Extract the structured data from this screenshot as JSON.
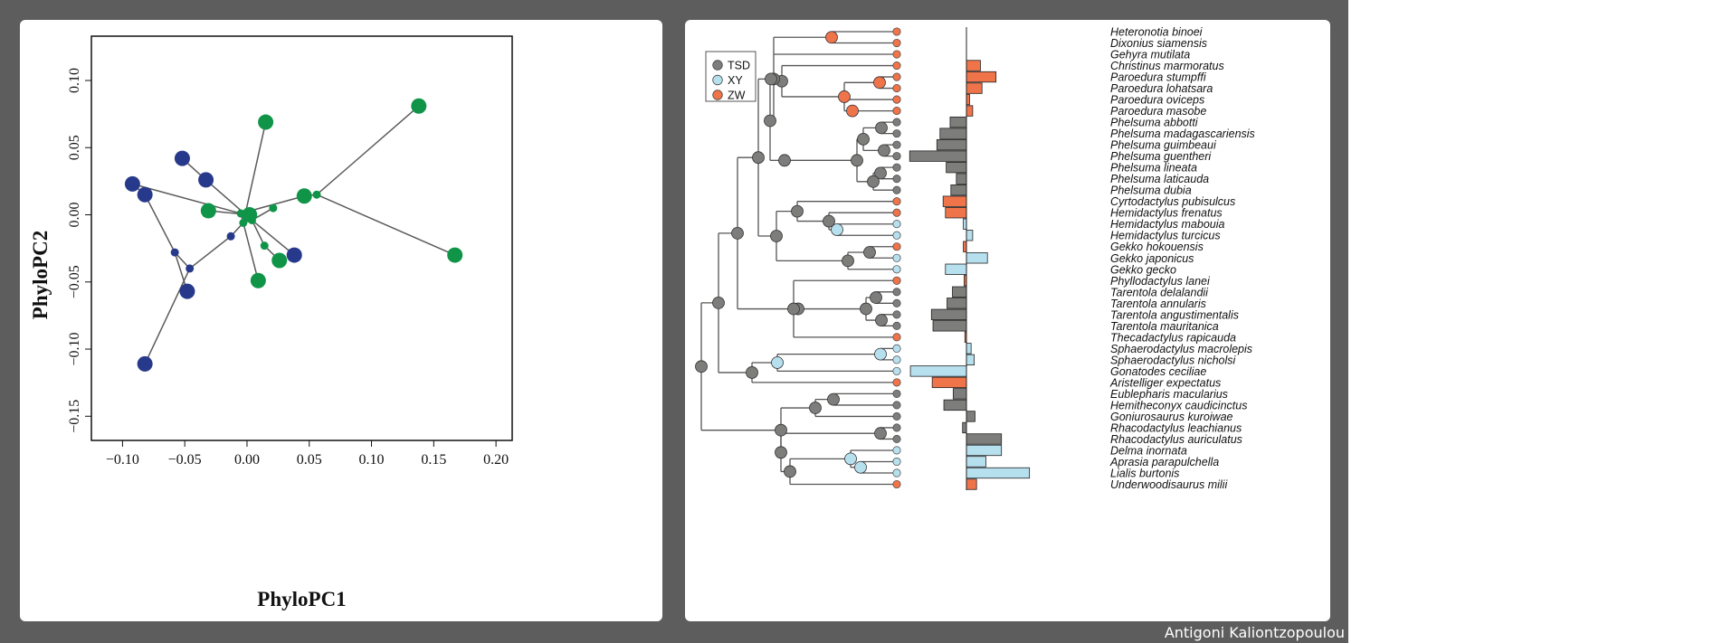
{
  "colors": {
    "TSD": "#7d7d7b",
    "XY": "#b7e0ef",
    "ZW": "#f0744a",
    "scatter_blue": "#27398a",
    "scatter_green": "#109448",
    "backdrop": "#5d5d5d"
  },
  "credit": "Antigoni Kaliontzopoulou",
  "chart_data": [
    {
      "type": "scatter",
      "xlabel": "PhyloPC1",
      "ylabel": "PhyloPC2",
      "xlim": [
        -0.125,
        0.213
      ],
      "ylim": [
        -0.168,
        0.133
      ],
      "xticks": [
        "−0.10",
        "−0.05",
        "0.00",
        "0.05",
        "0.10",
        "0.15",
        "0.20"
      ],
      "xtick_values": [
        -0.1,
        -0.05,
        0.0,
        0.05,
        0.1,
        0.15,
        0.2
      ],
      "yticks": [
        "−0.15",
        "−0.10",
        "−0.05",
        "0.00",
        "0.05",
        "0.10"
      ],
      "ytick_values": [
        -0.15,
        -0.1,
        -0.05,
        0.0,
        0.05,
        0.1
      ],
      "grid": false,
      "points": [
        {
          "id": "b1",
          "x": -0.052,
          "y": 0.042,
          "g": "blue",
          "size": "tip"
        },
        {
          "id": "b2",
          "x": -0.033,
          "y": 0.026,
          "g": "blue",
          "size": "tip"
        },
        {
          "id": "b3",
          "x": -0.092,
          "y": 0.023,
          "g": "blue",
          "size": "tip"
        },
        {
          "id": "b4",
          "x": -0.082,
          "y": 0.015,
          "g": "blue",
          "size": "tip"
        },
        {
          "id": "b5",
          "x": 0.038,
          "y": -0.03,
          "g": "blue",
          "size": "tip"
        },
        {
          "id": "b6",
          "x": -0.048,
          "y": -0.057,
          "g": "blue",
          "size": "tip"
        },
        {
          "id": "b7",
          "x": -0.082,
          "y": -0.111,
          "g": "blue",
          "size": "tip"
        },
        {
          "id": "bn1",
          "x": -0.058,
          "y": -0.028,
          "g": "blue",
          "size": "node"
        },
        {
          "id": "bn2",
          "x": -0.046,
          "y": -0.04,
          "g": "blue",
          "size": "node"
        },
        {
          "id": "bn3",
          "x": -0.013,
          "y": -0.016,
          "g": "blue",
          "size": "node"
        },
        {
          "id": "g1",
          "x": 0.138,
          "y": 0.081,
          "g": "green",
          "size": "tip"
        },
        {
          "id": "g2",
          "x": 0.015,
          "y": 0.069,
          "g": "green",
          "size": "tip"
        },
        {
          "id": "g3",
          "x": 0.046,
          "y": 0.014,
          "g": "green",
          "size": "tip"
        },
        {
          "id": "g4",
          "x": -0.031,
          "y": 0.003,
          "g": "green",
          "size": "tip"
        },
        {
          "id": "g5",
          "x": 0.002,
          "y": 0.0,
          "g": "green",
          "size": "tip"
        },
        {
          "id": "g6",
          "x": 0.167,
          "y": -0.03,
          "g": "green",
          "size": "tip"
        },
        {
          "id": "g7",
          "x": 0.026,
          "y": -0.034,
          "g": "green",
          "size": "tip"
        },
        {
          "id": "g8",
          "x": 0.009,
          "y": -0.049,
          "g": "green",
          "size": "tip"
        },
        {
          "id": "gn1",
          "x": -0.005,
          "y": 0.001,
          "g": "green",
          "size": "node"
        },
        {
          "id": "gn2",
          "x": 0.004,
          "y": -0.004,
          "g": "green",
          "size": "node"
        },
        {
          "id": "gn3",
          "x": -0.003,
          "y": -0.006,
          "g": "green",
          "size": "node"
        },
        {
          "id": "gn4",
          "x": 0.021,
          "y": 0.005,
          "g": "green",
          "size": "node"
        },
        {
          "id": "gn5",
          "x": 0.056,
          "y": 0.015,
          "g": "green",
          "size": "node"
        },
        {
          "id": "gn6",
          "x": 0.014,
          "y": -0.023,
          "g": "green",
          "size": "node"
        }
      ],
      "edges": [
        [
          "b1",
          "b2"
        ],
        [
          "b2",
          "gn2"
        ],
        [
          "b3",
          "b4"
        ],
        [
          "b3",
          "gn1"
        ],
        [
          "b4",
          "bn1"
        ],
        [
          "bn1",
          "bn2"
        ],
        [
          "bn1",
          "b6"
        ],
        [
          "bn2",
          "bn3"
        ],
        [
          "bn3",
          "gn3"
        ],
        [
          "b7",
          "bn2"
        ],
        [
          "b5",
          "gn2"
        ],
        [
          "g1",
          "gn5"
        ],
        [
          "gn5",
          "g3"
        ],
        [
          "g3",
          "gn1"
        ],
        [
          "gn5",
          "g6"
        ],
        [
          "g2",
          "gn3"
        ],
        [
          "g4",
          "g5"
        ],
        [
          "g5",
          "gn2"
        ],
        [
          "gn2",
          "gn4"
        ],
        [
          "gn2",
          "gn6"
        ],
        [
          "gn6",
          "g7"
        ],
        [
          "gn3",
          "g8"
        ],
        [
          "gn1",
          "gn3"
        ]
      ]
    },
    {
      "type": "bar",
      "legend": [
        "TSD",
        "XY",
        "ZW"
      ],
      "legend_position": "top-left",
      "categories": [
        "Heteronotia binoei",
        "Dixonius siamensis",
        "Gehyra mutilata",
        "Christinus marmoratus",
        "Paroedura stumpffi",
        "Paroedura lohatsara",
        "Paroedura oviceps",
        "Paroedura masobe",
        "Phelsuma abbotti",
        "Phelsuma madagascariensis",
        "Phelsuma guimbeaui",
        "Phelsuma guentheri",
        "Phelsuma lineata",
        "Phelsuma laticauda",
        "Phelsuma dubia",
        "Cyrtodactylus pubisulcus",
        "Hemidactylus frenatus",
        "Hemidactylus mabouia",
        "Hemidactylus turcicus",
        "Gekko hokouensis",
        "Gekko japonicus",
        "Gekko gecko",
        "Phyllodactylus lanei",
        "Tarentola delalandii",
        "Tarentola annularis",
        "Tarentola angustimentalis",
        "Tarentola mauritanica",
        "Thecadactylus rapicauda",
        "Sphaerodactylus macrolepis",
        "Sphaerodactylus nicholsi",
        "Gonatodes ceciliae",
        "Aristelliger expectatus",
        "Eublepharis macularius",
        "Hemitheconyx caudicinctus",
        "Goniurosaurus kuroiwae",
        "Rhacodactylus leachianus",
        "Rhacodactylus auriculatus",
        "Delma inornata",
        "Aprasia parapulchella",
        "Lialis burtonis",
        "Underwoodisaurus milii"
      ],
      "tip_state": [
        "ZW",
        "ZW",
        "ZW",
        "ZW",
        "ZW",
        "ZW",
        "ZW",
        "ZW",
        "TSD",
        "TSD",
        "TSD",
        "TSD",
        "TSD",
        "TSD",
        "TSD",
        "ZW",
        "ZW",
        "XY",
        "XY",
        "ZW",
        "XY",
        "XY",
        "ZW",
        "TSD",
        "TSD",
        "TSD",
        "TSD",
        "ZW",
        "XY",
        "XY",
        "XY",
        "ZW",
        "TSD",
        "TSD",
        "TSD",
        "TSD",
        "TSD",
        "XY",
        "XY",
        "XY",
        "ZW"
      ],
      "values": [
        0,
        0,
        0,
        1.8,
        3.8,
        2,
        0.4,
        0.8,
        -2.1,
        -3.4,
        -3.8,
        -7.3,
        -2.6,
        -1.3,
        -2,
        -3,
        -2.7,
        -0.4,
        0.8,
        -0.4,
        2.7,
        -2.7,
        -0.3,
        -1.8,
        -2.5,
        -4.5,
        -4.3,
        -0.2,
        0.6,
        1,
        -7.2,
        -4.4,
        -1.7,
        -2.9,
        1.1,
        -0.5,
        4.5,
        4.5,
        2.5,
        8.1,
        1.3
      ]
    }
  ]
}
